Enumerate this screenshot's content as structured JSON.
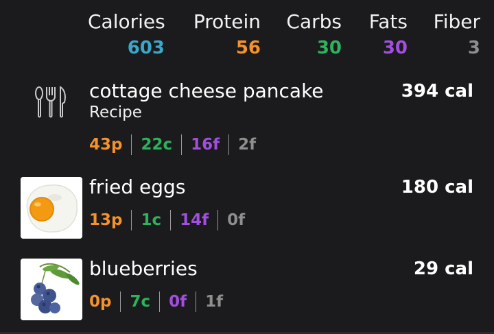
{
  "summary": {
    "calories": {
      "label": "Calories",
      "value": "603"
    },
    "protein": {
      "label": "Protein",
      "value": "56"
    },
    "carbs": {
      "label": "Carbs",
      "value": "30"
    },
    "fats": {
      "label": "Fats",
      "value": "30"
    },
    "fiber": {
      "label": "Fiber",
      "value": "3"
    }
  },
  "colors": {
    "calories": "#3aa7c9",
    "protein": "#f5922b",
    "carbs": "#2db35d",
    "fats": "#a24fe0",
    "fiber": "#8e8e8e"
  },
  "entries": [
    {
      "name": "cottage cheese pancake",
      "subtitle": "Recipe",
      "calories": "394 cal",
      "protein": "43p",
      "carbs": "22c",
      "fats": "16f",
      "fiber": "2f",
      "icon": "utensils-icon"
    },
    {
      "name": "fried eggs",
      "calories": "180 cal",
      "protein": "13p",
      "carbs": "1c",
      "fats": "14f",
      "fiber": "0f",
      "icon": "fried-egg-photo"
    },
    {
      "name": "blueberries",
      "calories": "29 cal",
      "protein": "0p",
      "carbs": "7c",
      "fats": "0f",
      "fiber": "1f",
      "icon": "blueberries-photo"
    }
  ]
}
